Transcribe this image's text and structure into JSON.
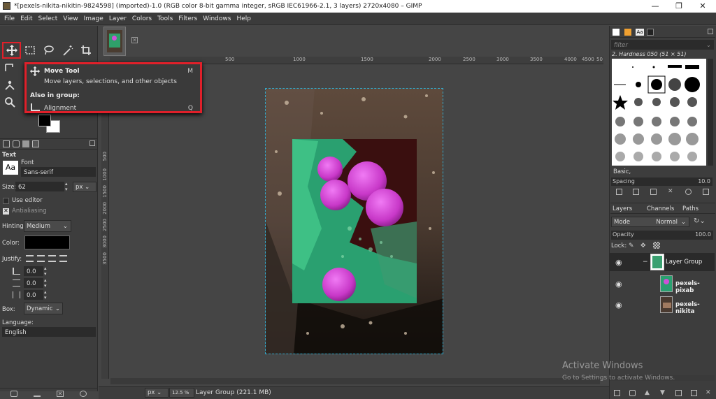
{
  "window": {
    "title": "*[pexels-nikita-nikitin-9824598] (imported)-1.0 (RGB color 8-bit gamma integer, sRGB IEC61966-2.1, 3 layers) 2720x4080 – GIMP",
    "minimize": "—",
    "restore": "❐",
    "close": "✕"
  },
  "menu": [
    "File",
    "Edit",
    "Select",
    "View",
    "Image",
    "Layer",
    "Colors",
    "Tools",
    "Filters",
    "Windows",
    "Help"
  ],
  "tooltip": {
    "title": "Move Tool",
    "shortcut": "M",
    "description": "Move layers, selections, and other objects",
    "group_heading": "Also in group:",
    "group_item": "Alignment",
    "group_shortcut": "Q"
  },
  "tool_options": {
    "title": "Text",
    "font_label": "Font",
    "font_preview": "Aa",
    "font_value": "Sans-serif",
    "size_label": "Size:",
    "size_value": "62",
    "size_unit": "px",
    "use_editor": "Use editor",
    "antialiasing": "Antialiasing",
    "hinting_label": "Hinting:",
    "hinting_value": "Medium",
    "color_label": "Color:",
    "justify_label": "Justify:",
    "indent_value": "0.0",
    "line_spacing_value": "0.0",
    "letter_spacing_value": "0.0",
    "box_label": "Box:",
    "box_value": "Dynamic",
    "language_label": "Language:",
    "language_value": "English"
  },
  "rulers": {
    "h_ticks": [
      "500",
      "1000",
      "1500",
      "2000",
      "2500",
      "3000",
      "3500",
      "4000",
      "4500",
      "50"
    ],
    "v_ticks": [
      "500",
      "1000",
      "1500",
      "2000",
      "2500",
      "3000",
      "3500"
    ]
  },
  "status": {
    "unit": "px",
    "zoom": "12.5 %",
    "layer_info": "Layer Group (221.1 MB)"
  },
  "brushes": {
    "filter_placeholder": "filter",
    "current_brush": "2. Hardness 050 (51 × 51)",
    "preset": "Basic,",
    "spacing_label": "Spacing",
    "spacing_value": "10.0"
  },
  "layers_panel": {
    "tabs": [
      "Layers",
      "Channels",
      "Paths"
    ],
    "mode_label": "Mode",
    "mode_value": "Normal",
    "opacity_label": "Opacity",
    "opacity_value": "100.0",
    "lock_label": "Lock:",
    "layers": [
      {
        "name": "Layer Group"
      },
      {
        "name": "pexels-pixab"
      },
      {
        "name": "pexels-nikita"
      }
    ]
  },
  "watermark": {
    "line1": "Activate Windows",
    "line2": "Go to Settings to activate Windows."
  },
  "colors": {
    "highlight_red": "#e0202a",
    "canvas_border": "#33aacc",
    "app_bg": "#454545"
  }
}
